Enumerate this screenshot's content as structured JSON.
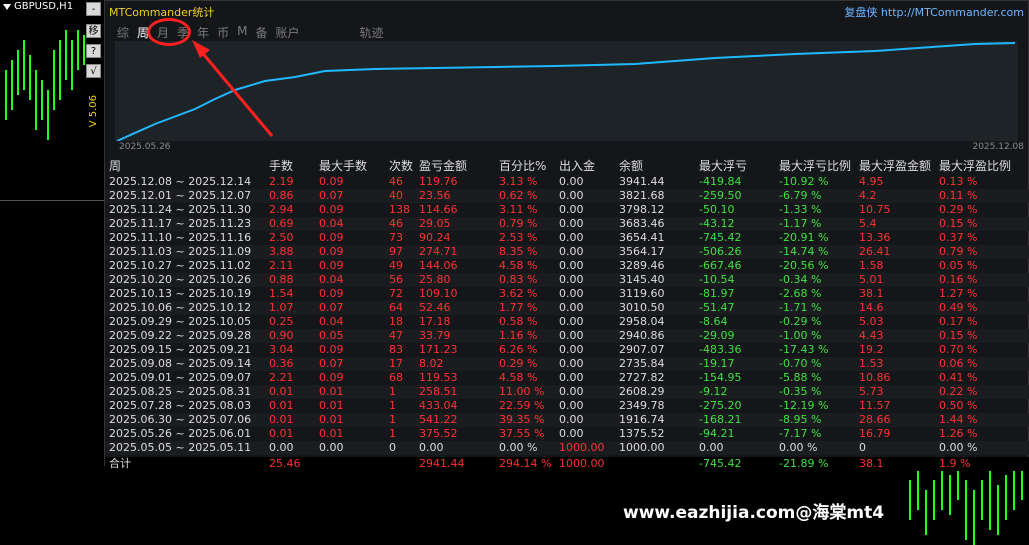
{
  "symbol": "GBPUSD,H1",
  "side_buttons": [
    "-",
    "移",
    "?",
    "√"
  ],
  "side_label": "V 5.06",
  "panel": {
    "title": "MTCommander统计",
    "link": "复盘侠 http://MTCommander.com",
    "tabs": [
      "综",
      "周",
      "月",
      "季",
      "年",
      "币",
      "M",
      "备",
      "账户",
      "轨迹"
    ],
    "active_tab": "周",
    "date_start": "2025.05.26",
    "date_end": "2025.12.08"
  },
  "table": {
    "headers": [
      "周",
      "手数",
      "最大手数",
      "次数",
      "盈亏金额",
      "百分比%",
      "出入金",
      "余额",
      "最大浮亏",
      "最大浮亏比例",
      "最大浮盈金额",
      "最大浮盈比例"
    ],
    "rows": [
      [
        "2025.12.08 ~ 2025.12.14",
        "2.19",
        "0.09",
        "46",
        "119.76",
        "3.13 %",
        "0.00",
        "3941.44",
        "-419.84",
        "-10.92 %",
        "4.95",
        "0.13 %"
      ],
      [
        "2025.12.01 ~ 2025.12.07",
        "0.86",
        "0.07",
        "40",
        "23.56",
        "0.62 %",
        "0.00",
        "3821.68",
        "-259.50",
        "-6.79 %",
        "4.2",
        "0.11 %"
      ],
      [
        "2025.11.24 ~ 2025.11.30",
        "2.94",
        "0.09",
        "138",
        "114.66",
        "3.11 %",
        "0.00",
        "3798.12",
        "-50.10",
        "-1.33 %",
        "10.75",
        "0.29 %"
      ],
      [
        "2025.11.17 ~ 2025.11.23",
        "0.69",
        "0.04",
        "46",
        "29.05",
        "0.79 %",
        "0.00",
        "3683.46",
        "-43.12",
        "-1.17 %",
        "5.4",
        "0.15 %"
      ],
      [
        "2025.11.10 ~ 2025.11.16",
        "2.50",
        "0.09",
        "73",
        "90.24",
        "2.53 %",
        "0.00",
        "3654.41",
        "-745.42",
        "-20.91 %",
        "13.36",
        "0.37 %"
      ],
      [
        "2025.11.03 ~ 2025.11.09",
        "3.88",
        "0.09",
        "97",
        "274.71",
        "8.35 %",
        "0.00",
        "3564.17",
        "-506.26",
        "-14.74 %",
        "26.41",
        "0.79 %"
      ],
      [
        "2025.10.27 ~ 2025.11.02",
        "2.11",
        "0.09",
        "49",
        "144.06",
        "4.58 %",
        "0.00",
        "3289.46",
        "-667.46",
        "-20.56 %",
        "1.58",
        "0.05 %"
      ],
      [
        "2025.10.20 ~ 2025.10.26",
        "0.88",
        "0.04",
        "56",
        "25.80",
        "0.83 %",
        "0.00",
        "3145.40",
        "-10.54",
        "-0.34 %",
        "5.01",
        "0.16 %"
      ],
      [
        "2025.10.13 ~ 2025.10.19",
        "1.54",
        "0.09",
        "72",
        "109.10",
        "3.62 %",
        "0.00",
        "3119.60",
        "-81.97",
        "-2.68 %",
        "38.1",
        "1.27 %"
      ],
      [
        "2025.10.06 ~ 2025.10.12",
        "1.07",
        "0.07",
        "64",
        "52.46",
        "1.77 %",
        "0.00",
        "3010.50",
        "-51.47",
        "-1.71 %",
        "14.6",
        "0.49 %"
      ],
      [
        "2025.09.29 ~ 2025.10.05",
        "0.25",
        "0.04",
        "18",
        "17.18",
        "0.58 %",
        "0.00",
        "2958.04",
        "-8.64",
        "-0.29 %",
        "5.03",
        "0.17 %"
      ],
      [
        "2025.09.22 ~ 2025.09.28",
        "0.90",
        "0.05",
        "47",
        "33.79",
        "1.16 %",
        "0.00",
        "2940.86",
        "-29.09",
        "-1.00 %",
        "4.43",
        "0.15 %"
      ],
      [
        "2025.09.15 ~ 2025.09.21",
        "3.04",
        "0.09",
        "83",
        "171.23",
        "6.26 %",
        "0.00",
        "2907.07",
        "-483.36",
        "-17.43 %",
        "19.2",
        "0.70 %"
      ],
      [
        "2025.09.08 ~ 2025.09.14",
        "0.36",
        "0.07",
        "17",
        "8.02",
        "0.29 %",
        "0.00",
        "2735.84",
        "-19.17",
        "-0.70 %",
        "1.53",
        "0.06 %"
      ],
      [
        "2025.09.01 ~ 2025.09.07",
        "2.21",
        "0.09",
        "68",
        "119.53",
        "4.58 %",
        "0.00",
        "2727.82",
        "-154.95",
        "-5.88 %",
        "10.86",
        "0.41 %"
      ],
      [
        "2025.08.25 ~ 2025.08.31",
        "0.01",
        "0.01",
        "1",
        "258.51",
        "11.00 %",
        "0.00",
        "2608.29",
        "-9.12",
        "-0.35 %",
        "5.73",
        "0.22 %"
      ],
      [
        "2025.07.28 ~ 2025.08.03",
        "0.01",
        "0.01",
        "1",
        "433.04",
        "22.59 %",
        "0.00",
        "2349.78",
        "-275.20",
        "-12.19 %",
        "11.57",
        "0.50 %"
      ],
      [
        "2025.06.30 ~ 2025.07.06",
        "0.01",
        "0.01",
        "1",
        "541.22",
        "39.35 %",
        "0.00",
        "1916.74",
        "-168.21",
        "-8.95 %",
        "28.66",
        "1.44 %"
      ],
      [
        "2025.05.26 ~ 2025.06.01",
        "0.01",
        "0.01",
        "1",
        "375.52",
        "37.55 %",
        "0.00",
        "1375.52",
        "-94.21",
        "-7.17 %",
        "16.79",
        "1.26 %"
      ],
      [
        "2025.05.05 ~ 2025.05.11",
        "0.00",
        "0.00",
        "0",
        "0.00",
        "0.00 %",
        "1000.00",
        "1000.00",
        "0.00",
        "0.00 %",
        "0",
        "0.00 %"
      ]
    ],
    "total": [
      "合计",
      "25.46",
      "",
      "",
      "2941.44",
      "294.14 %",
      "1000.00",
      "",
      "-745.42",
      "-21.89 %",
      "38.1",
      "1.9 %"
    ]
  },
  "watermark": "www.eazhijia.com@海棠mt4"
}
